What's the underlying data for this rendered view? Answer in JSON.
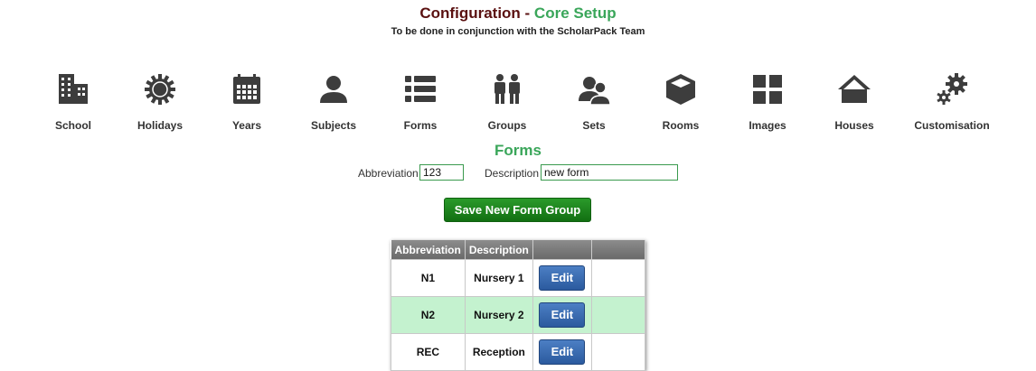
{
  "header": {
    "title_main": "Configuration",
    "title_sep": " - ",
    "title_sub": "Core Setup",
    "subtitle": "To be done in conjunction with the ScholarPack Team"
  },
  "nav": {
    "items": [
      {
        "label": "School",
        "icon": "building-icon"
      },
      {
        "label": "Holidays",
        "icon": "sun-icon"
      },
      {
        "label": "Years",
        "icon": "calendar-icon"
      },
      {
        "label": "Subjects",
        "icon": "person-icon"
      },
      {
        "label": "Forms",
        "icon": "list-icon"
      },
      {
        "label": "Groups",
        "icon": "people-icon"
      },
      {
        "label": "Sets",
        "icon": "users-icon"
      },
      {
        "label": "Rooms",
        "icon": "cube-icon"
      },
      {
        "label": "Images",
        "icon": "grid-icon"
      },
      {
        "label": "Houses",
        "icon": "home-icon"
      },
      {
        "label": "Customisation",
        "icon": "gears-icon"
      }
    ]
  },
  "section": {
    "title": "Forms"
  },
  "form": {
    "abbreviation_label": "Abbreviation",
    "abbreviation_value": "123",
    "description_label": "Description",
    "description_value": "new form",
    "save_label": "Save New Form Group"
  },
  "table": {
    "headers": [
      "Abbreviation",
      "Description",
      "",
      ""
    ],
    "rows": [
      {
        "abbreviation": "N1",
        "description": "Nursery 1",
        "action": "Edit"
      },
      {
        "abbreviation": "N2",
        "description": "Nursery 2",
        "action": "Edit"
      },
      {
        "abbreviation": "REC",
        "description": "Reception",
        "action": "Edit"
      }
    ]
  },
  "colors": {
    "title_dark": "#5a1010",
    "title_green": "#3aa65a",
    "save_green": "#1e8a1e",
    "edit_blue": "#3a6bb0",
    "row_highlight": "#c4f2cf",
    "icon_grey": "#3d3d3d"
  }
}
